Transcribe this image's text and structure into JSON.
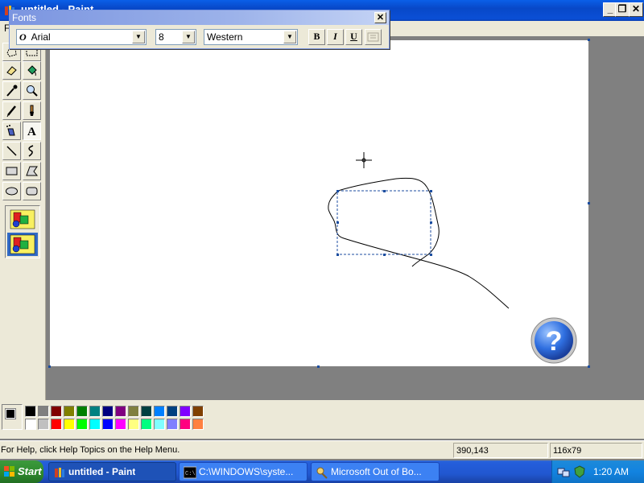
{
  "window": {
    "title": "untitled - Paint"
  },
  "menu": {
    "first_item": "F"
  },
  "fonts_toolbar": {
    "title": "Fonts",
    "font_glyph": "O",
    "font_name": "Arial",
    "font_size": "8",
    "script": "Western",
    "bold_label": "B",
    "italic_label": "I",
    "underline_label": "U"
  },
  "tools": [
    "free-form-select",
    "select",
    "eraser",
    "fill-with-color",
    "pick-color",
    "magnifier",
    "pencil",
    "brush",
    "airbrush",
    "text",
    "line",
    "curve",
    "rectangle",
    "polygon",
    "ellipse",
    "rounded-rectangle"
  ],
  "active_tool": "text",
  "palette": {
    "foreground": "#000000",
    "background": "#ffffff",
    "row1": [
      "#000000",
      "#808080",
      "#800000",
      "#808000",
      "#008000",
      "#008080",
      "#000080",
      "#800080",
      "#808040",
      "#004040",
      "#0080ff",
      "#004080",
      "#8000ff",
      "#804000"
    ],
    "row2": [
      "#ffffff",
      "#c0c0c0",
      "#ff0000",
      "#ffff00",
      "#00ff00",
      "#00ffff",
      "#0000ff",
      "#ff00ff",
      "#ffff80",
      "#00ff80",
      "#80ffff",
      "#8080ff",
      "#ff0080",
      "#ff8040"
    ]
  },
  "status": {
    "help_text": "For Help, click Help Topics on the Help Menu.",
    "coordinates": "390,143",
    "selection_size": "116x79"
  },
  "taskbar": {
    "start_label": "Start",
    "tasks": [
      {
        "label": "untitled - Paint",
        "icon": "paint-icon",
        "active": true
      },
      {
        "label": "C:\\WINDOWS\\syste...",
        "icon": "cmd-icon",
        "active": false
      },
      {
        "label": "Microsoft Out of Bo...",
        "icon": "oobe-icon",
        "active": false
      }
    ],
    "clock": "1:20 AM"
  }
}
